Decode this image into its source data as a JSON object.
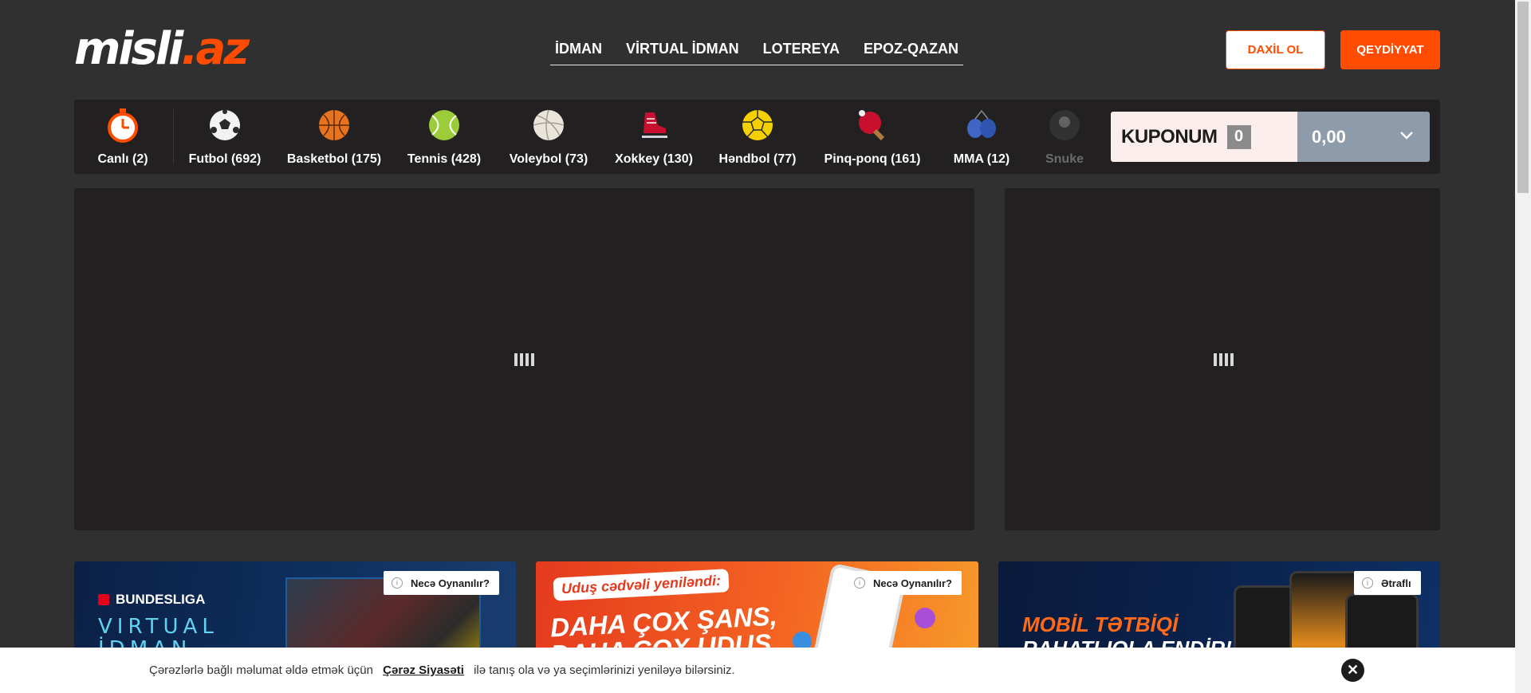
{
  "header": {
    "logo_main": "misli",
    "logo_accent": ".az",
    "nav": [
      "İDMAN",
      "VİRTUAL İDMAN",
      "LOTEREYA",
      "EPOZ-QAZAN"
    ],
    "login_label": "DAXİL OL",
    "register_label": "QEYDİYYAT"
  },
  "sports": [
    {
      "label": "Canlı (2)",
      "icon": "stopwatch-icon"
    },
    {
      "label": "Futbol (692)",
      "icon": "football-icon"
    },
    {
      "label": "Basketbol (175)",
      "icon": "basketball-icon"
    },
    {
      "label": "Tennis (428)",
      "icon": "tennis-ball-icon"
    },
    {
      "label": "Voleybol (73)",
      "icon": "volleyball-icon"
    },
    {
      "label": "Xokkey (130)",
      "icon": "ice-skate-icon"
    },
    {
      "label": "Həndbol (77)",
      "icon": "handball-icon"
    },
    {
      "label": "Pinq-ponq (161)",
      "icon": "ping-pong-icon"
    },
    {
      "label": "MMA (12)",
      "icon": "boxing-gloves-icon"
    },
    {
      "label": "Snuke",
      "icon": "snooker-ball-icon"
    }
  ],
  "coupon": {
    "title": "KUPONUM",
    "count": "0",
    "amount": "0,00"
  },
  "banners": [
    {
      "tag": "Necə Oynanılır?",
      "brand": "BUNDESLIGA",
      "lines": [
        "VIRTUAL",
        "İDMAN"
      ]
    },
    {
      "tag": "Necə Oynanılır?",
      "pill": "Uduş cədvəli yeniləndi:",
      "lines": [
        "DAHA ÇOX ŞANS,",
        "DAHA ÇOX UDUŞ"
      ]
    },
    {
      "tag": "Ətraflı",
      "lines": [
        "MOBİL TƏTBİQİ",
        "RAHATLIQLA ENDİR!"
      ]
    }
  ],
  "cookie": {
    "before": "Çərəzlərlə bağlı məlumat əldə etmək üçün",
    "link": "Çərəz Siyasəti",
    "after": "ilə tanış ola və ya seçimlərinizi yeniləyə bilərsiniz.",
    "close": "✕"
  },
  "colors": {
    "accent": "#ff4c00",
    "background": "#313030",
    "panel": "#222020",
    "coupon_amount_bg": "#8d9bab"
  }
}
